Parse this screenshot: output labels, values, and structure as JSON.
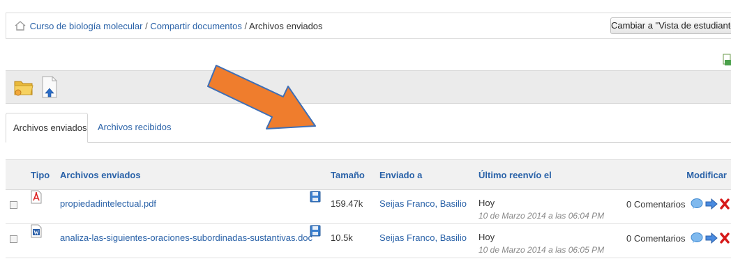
{
  "breadcrumb": {
    "items": [
      "Curso de biología molecular",
      "Compartir documentos"
    ],
    "separator": "/",
    "current": "Archivos enviados"
  },
  "header": {
    "student_view_button": "Cambiar a \"Vista de estudiante\""
  },
  "tabs": [
    {
      "label": "Archivos enviados",
      "active": true
    },
    {
      "label": "Archivos recibidos",
      "active": false
    }
  ],
  "table": {
    "columns": {
      "type": "Tipo",
      "name": "Archivos enviados",
      "size": "Tamaño",
      "sent_to": "Enviado a",
      "last_resend": "Último reenvío el",
      "modify": "Modificar"
    },
    "rows": [
      {
        "type_icon": "pdf-icon",
        "name": "propiedadintelectual.pdf",
        "size": "159.47k",
        "sent_to": "Seijas Franco, Basilio",
        "date_rel": "Hoy",
        "date_full": "10 de Marzo 2014 a las 06:04 PM",
        "comments": "0 Comentarios"
      },
      {
        "type_icon": "word-doc-icon",
        "name": "analiza-las-siguientes-oraciones-subordinadas-sustantivas.doc",
        "size": "10.5k",
        "sent_to": "Seijas Franco, Basilio",
        "date_rel": "Hoy",
        "date_full": "10 de Marzo 2014 a las 06:05 PM",
        "comments": "0 Comentarios"
      }
    ]
  },
  "colors": {
    "link": "#2a62a8",
    "arrow": "#ef7d2d",
    "arrow_outline": "#3f6fb5",
    "toolbar_bg": "#ebebeb"
  }
}
